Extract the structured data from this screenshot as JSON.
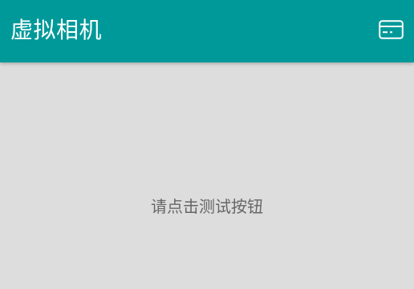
{
  "toolbar": {
    "title": "虚拟相机",
    "action_icon": "credit-card-icon"
  },
  "main": {
    "hint_text": "请点击测试按钮"
  },
  "colors": {
    "toolbar_bg": "#009999",
    "content_bg": "#dddddd",
    "title_text": "#ffffff",
    "hint_text": "#666666"
  }
}
